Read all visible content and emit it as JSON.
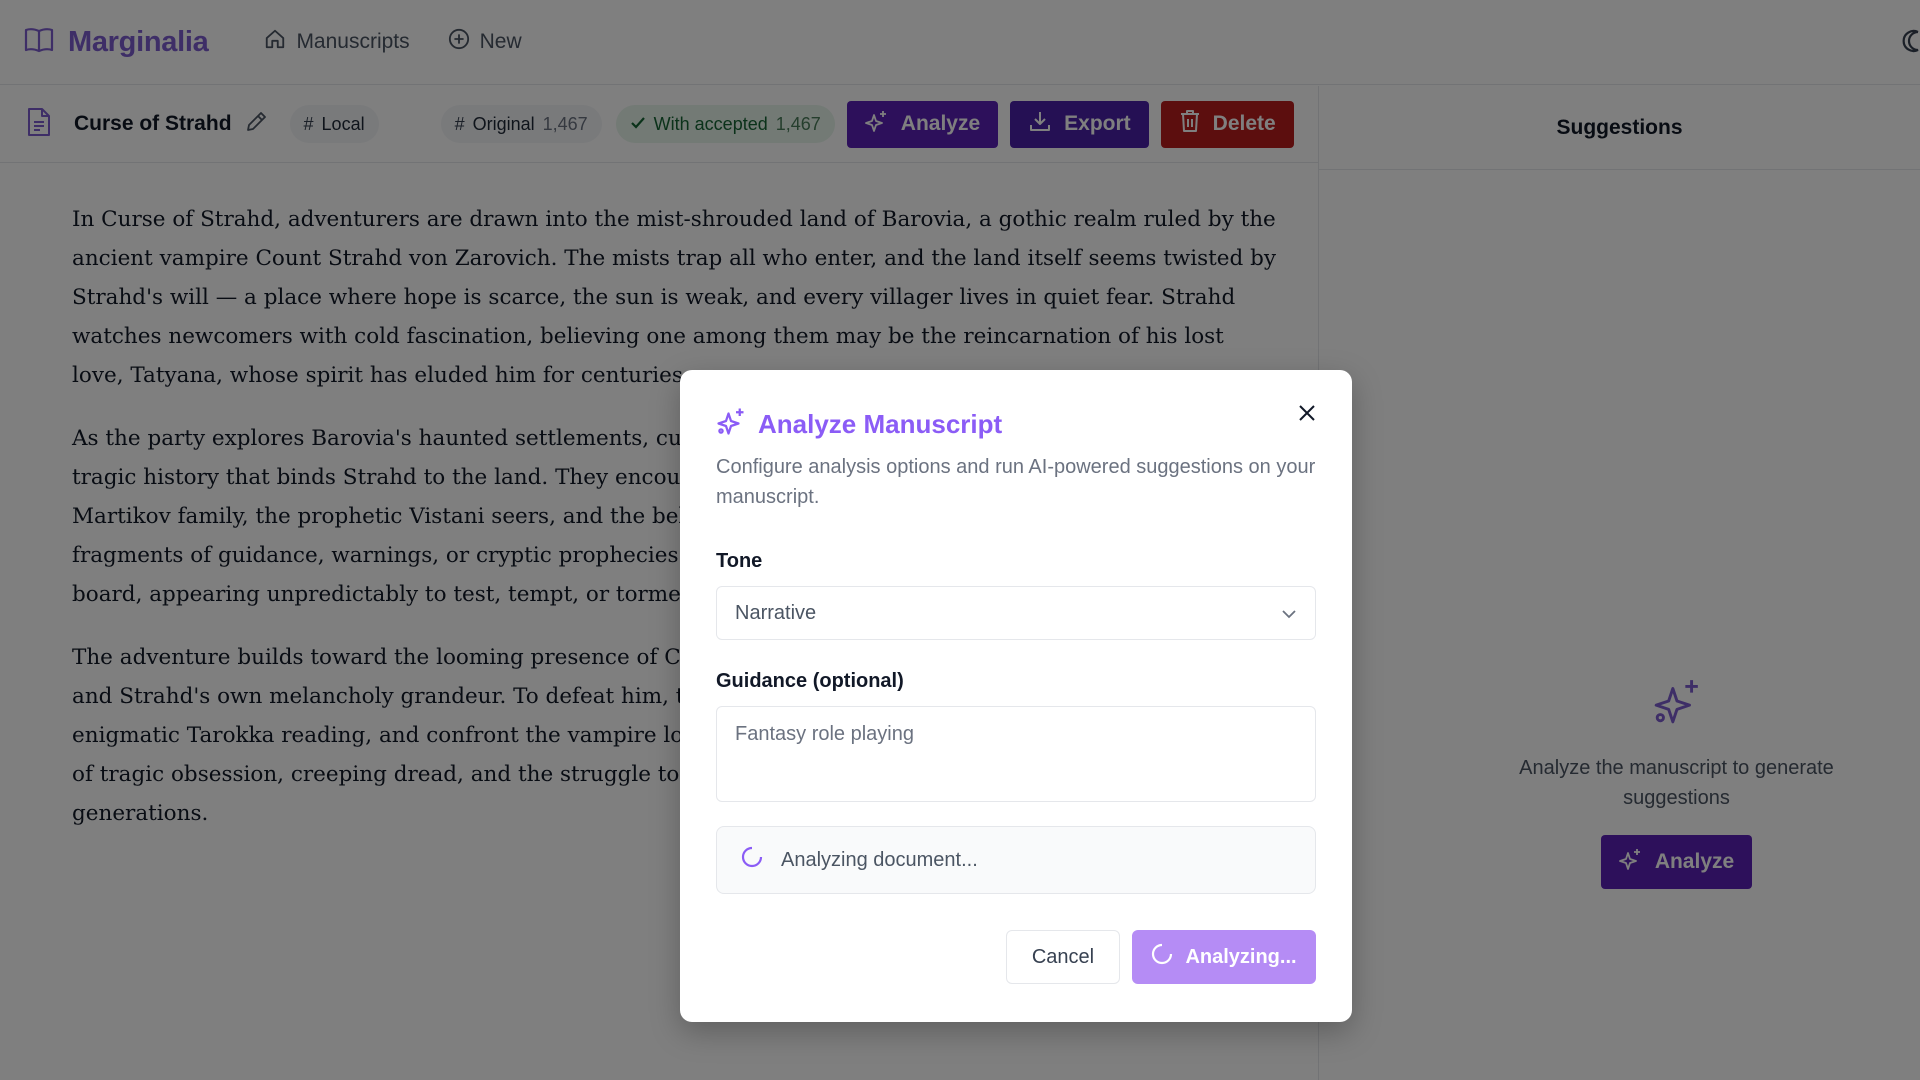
{
  "nav": {
    "brand": "Marginalia",
    "links": [
      {
        "label": "Manuscripts",
        "icon": "home-icon"
      },
      {
        "label": "New",
        "icon": "plus-circle-icon"
      }
    ],
    "theme_icon": "moon-icon"
  },
  "toolbar": {
    "title": "Curse of Strahd",
    "storage_label": "Local",
    "original_label": "Original",
    "original_count": "1,467",
    "accepted_label": "With accepted",
    "accepted_count": "1,467",
    "analyze_label": "Analyze",
    "export_label": "Export",
    "delete_label": "Delete"
  },
  "manuscript": {
    "paragraphs": [
      "In Curse of Strahd, adventurers are drawn into the mist-shrouded land of Barovia, a gothic realm ruled by the ancient vampire Count Strahd von Zarovich. The mists trap all who enter, and the land itself seems twisted by Strahd's will — a place where hope is scarce, the sun is weak, and every villager lives in quiet fear. Strahd watches newcomers with cold fascination, believing one among them may be the reincarnation of his lost love, Tatyana, whose spirit has eluded him for centuries.",
      "As the party explores Barovia's haunted settlements, curse",
      "The adventure builds toward the looming presence of Cas"
    ],
    "p2_lines": [
      "As the party explores Barovia's haunted settlements, curse",
      "tragic history that binds Strahd to the land. They encount",
      "Martikov family, the prophetic Vistani seers, and the belea",
      "fragments of guidance, warnings, or cryptic prophecies. M",
      "board, appearing unpredictably to test, tempt, or torment"
    ],
    "p3_lines": [
      "The adventure builds toward the looming presence of Cas",
      "and Strahd's own melancholy grandeur. To defeat him, th",
      "enigmatic Tarokka reading, and confront the vampire lord",
      "of tragic obsession, creeping dread, and the struggle to bre",
      "generations."
    ]
  },
  "suggestions": {
    "title": "Suggestions",
    "empty_message": "Analyze the manuscript to generate suggestions",
    "analyze_label": "Analyze"
  },
  "modal": {
    "title": "Analyze Manuscript",
    "description": "Configure analysis options and run AI-powered suggestions on your manuscript.",
    "tone_label": "Tone",
    "tone_value": "Narrative",
    "guidance_label": "Guidance (optional)",
    "guidance_placeholder": "Fantasy role playing",
    "status_text": "Analyzing document...",
    "cancel_label": "Cancel",
    "submit_label": "Analyzing..."
  },
  "colors": {
    "brand": "#7c5ccf",
    "primary": "#5b21b6",
    "danger": "#b91c1c",
    "accent_light": "#b58cf5"
  }
}
